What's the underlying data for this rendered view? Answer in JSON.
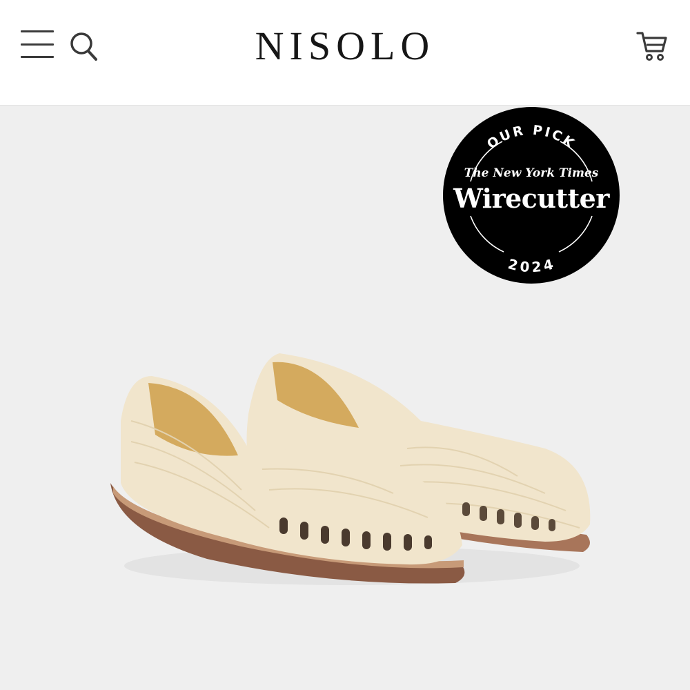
{
  "header": {
    "brand": "NISOLO",
    "menu_icon": "hamburger-menu-icon",
    "search_icon": "search-icon",
    "cart_icon": "shopping-cart-icon"
  },
  "badge": {
    "top_text": "OUR PICK",
    "publisher": "The New York Times",
    "title": "Wirecutter",
    "year": "2024"
  },
  "product_image": {
    "icon": "huarache-sandals-image"
  },
  "colors": {
    "header_bg": "#ffffff",
    "page_bg": "#efefef",
    "brand_text": "#161616",
    "badge_bg": "#000000",
    "shoe_leather": "#f1e5cc",
    "shoe_lining": "#d4aa5e",
    "sole": "#8a5a44"
  }
}
